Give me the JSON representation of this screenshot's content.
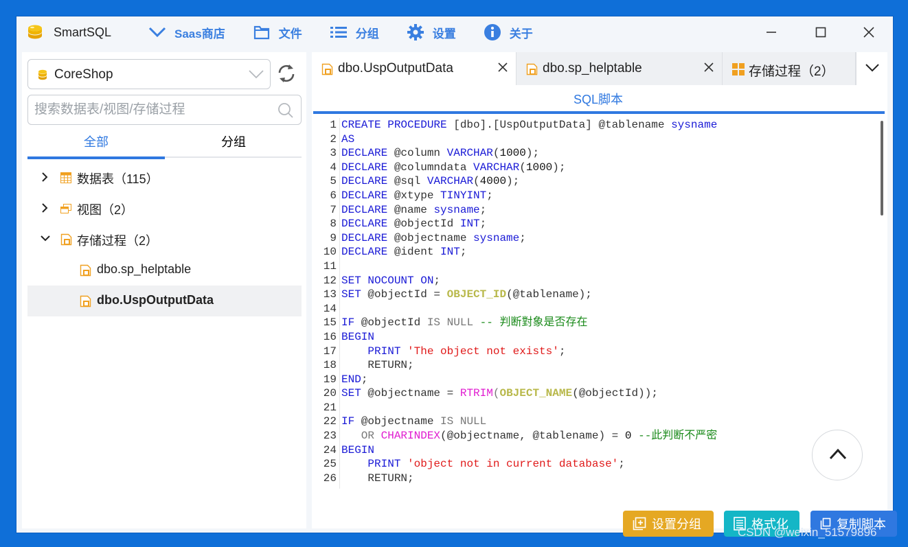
{
  "app": {
    "title": "SmartSQL"
  },
  "menu": [
    {
      "label": "Saas商店",
      "icon": "chevron-down-icon"
    },
    {
      "label": "文件",
      "icon": "folder-icon"
    },
    {
      "label": "分组",
      "icon": "list-icon"
    },
    {
      "label": "设置",
      "icon": "gear-icon"
    },
    {
      "label": "关于",
      "icon": "info-icon"
    }
  ],
  "sidebar": {
    "database": "CoreShop",
    "search_placeholder": "搜索数据表/视图/存储过程",
    "tabs": [
      "全部",
      "分组"
    ],
    "active_tab": "全部",
    "tree": [
      {
        "label": "数据表（115）",
        "expanded": false,
        "icon": "table-icon"
      },
      {
        "label": "视图（2）",
        "expanded": false,
        "icon": "view-icon"
      },
      {
        "label": "存储过程（2）",
        "expanded": true,
        "icon": "procedure-icon"
      },
      {
        "label": "dbo.sp_helptable",
        "icon": "procedure-file-icon"
      },
      {
        "label": "dbo.UspOutputData",
        "icon": "procedure-file-icon",
        "selected": true
      }
    ]
  },
  "editor_tabs": [
    {
      "label": "dbo.UspOutputData",
      "active": true
    },
    {
      "label": "dbo.sp_helptable",
      "active": false
    },
    {
      "label": "存储过程（2）",
      "active": false
    }
  ],
  "subtab": "SQL脚本",
  "code_lines": [
    "1",
    "2",
    "3",
    "4",
    "5",
    "6",
    "7",
    "8",
    "9",
    "10",
    "11",
    "12",
    "13",
    "14",
    "15",
    "16",
    "17",
    "18",
    "19",
    "20",
    "21",
    "22",
    "23",
    "24",
    "25",
    "26"
  ],
  "code": {
    "l1_a": "CREATE PROCEDURE",
    "l1_b": " [dbo].[UspOutputData] @tablename ",
    "l1_c": "sysname",
    "l2": "AS",
    "declare": "DECLARE",
    "l3_v": " @column ",
    "l3_t": "VARCHAR",
    "l3_n": "1000",
    "l4_v": " @columndata ",
    "l4_t": "VARCHAR",
    "l4_n": "1000",
    "l5_v": " @sql ",
    "l5_t": "VARCHAR",
    "l5_n": "4000",
    "l6_v": " @xtype ",
    "l6_t": "TINYINT",
    "l7_v": " @name ",
    "l7_t": "sysname",
    "l8_v": " @objectId ",
    "l8_t": "INT",
    "l9_v": " @objectname ",
    "l9_t": "sysname",
    "l10_v": " @ident ",
    "l10_t": "INT",
    "l12_a": "SET NOCOUNT ON",
    "set": "SET",
    "l13_b": " @objectId = ",
    "l13_f": "OBJECT_ID",
    "l13_c": "(@tablename);",
    "l15_a": "IF",
    "l15_b": " @objectId ",
    "l15_c": "IS NULL",
    "l15_d": " -- 判断對象是否存在",
    "begin": "BEGIN",
    "print": "PRINT",
    "l17_s": " 'The object not exists'",
    "l18": "    RETURN;",
    "end": "END",
    "l20_b": " @objectname = ",
    "l20_f1": "RTRIM",
    "l20_f2": "OBJECT_NAME",
    "l20_c": "(@objectId));",
    "l22_a": "IF",
    "l22_b": " @objectname ",
    "l22_c": "IS NULL",
    "l23_a": "   OR ",
    "l23_f": "CHARINDEX",
    "l23_b": "(@objectname, @tablename) = ",
    "l23_n": "0",
    "l23_c": " --此判断不严密",
    "l25_s": " 'object not in current database'",
    "l26": "    RETURN;"
  },
  "actions": {
    "group": "设置分组",
    "format": "格式化",
    "copy": "复制脚本"
  },
  "watermark": "CSDN @weixin_51579896",
  "colors": {
    "accent": "#2f78e0",
    "gold": "#e5a823",
    "cyan": "#14b6c6",
    "background": "#0f6fd8"
  }
}
